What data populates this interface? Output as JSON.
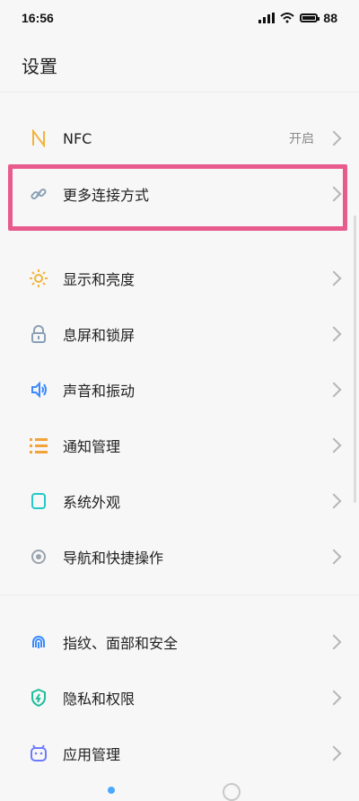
{
  "status": {
    "time": "16:56",
    "battery": "88"
  },
  "page": {
    "title": "设置"
  },
  "group1": [
    {
      "label": "NFC",
      "value": "开启",
      "icon": "nfc-icon",
      "color": "#f2b43a"
    },
    {
      "label": "更多连接方式",
      "value": "",
      "icon": "link-icon",
      "color": "#8aa0b5"
    }
  ],
  "group2": [
    {
      "label": "显示和亮度",
      "icon": "sun-icon",
      "color": "#f2b43a"
    },
    {
      "label": "息屏和锁屏",
      "icon": "lock-icon",
      "color": "#8aa0b5"
    },
    {
      "label": "声音和振动",
      "icon": "speaker-icon",
      "color": "#3b8bff"
    },
    {
      "label": "通知管理",
      "icon": "list-icon",
      "color": "#f2a33a"
    },
    {
      "label": "系统外观",
      "icon": "phone-icon",
      "color": "#23c7c7"
    },
    {
      "label": "导航和快捷操作",
      "icon": "navigation-icon",
      "color": "#9aa4ad"
    }
  ],
  "group3": [
    {
      "label": "指纹、面部和安全",
      "icon": "fingerprint-icon",
      "color": "#3b8bff"
    },
    {
      "label": "隐私和权限",
      "icon": "shield-icon",
      "color": "#1fbf9c"
    },
    {
      "label": "应用管理",
      "icon": "apps-icon",
      "color": "#6c7bff"
    }
  ]
}
